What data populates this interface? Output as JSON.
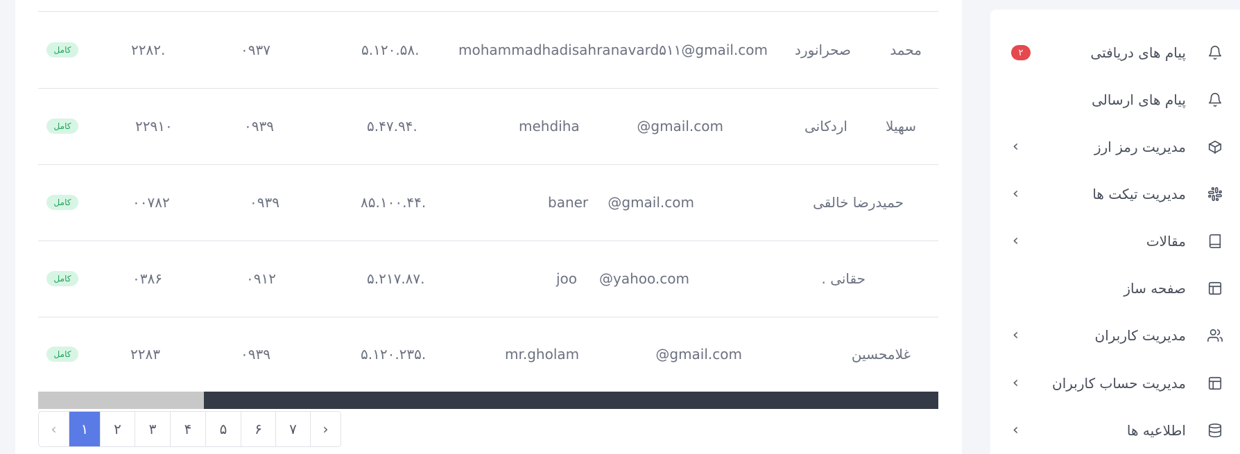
{
  "table": {
    "rows": [
      {
        "name": "محمد",
        "family": "صحرانورد",
        "email": "mohammadhadisahranavard۵۱۱@gmail.com",
        "ip": "۵.۱۲۰.۵۸.",
        "mobile": "۰۹۳۷",
        "code": "۲۲۸۲.",
        "status": "کامل"
      },
      {
        "name": "سهیلا",
        "family": "اردکانی",
        "username": "mehdiha",
        "email": "@gmail.com",
        "ip": "۵.۴۷.۹۴.",
        "mobile": "۰۹۳۹",
        "code": "۲۲۹۱۰",
        "status": "کامل"
      },
      {
        "name": "حمیدرضا خالقی",
        "family": "",
        "username": "baner",
        "email": "@gmail.com",
        "ip": "۸۵.۱۰۰.۴۴.",
        "mobile": "۰۹۳۹",
        "code": "۰۰۷۸۲",
        "status": "کامل"
      },
      {
        "name": "",
        "family": ". حقانی",
        "username": "joo",
        "email": "@yahoo.com",
        "ip": "۵.۲۱۷.۸۷.",
        "mobile": "۰۹۱۲",
        "code": "۰۳۸۶",
        "status": "کامل"
      },
      {
        "name": "غلامحسین",
        "family": "",
        "username": "mr.gholam",
        "email": "@gmail.com",
        "ip": "۵.۱۲۰.۲۳۵.",
        "mobile": "۰۹۳۹",
        "code": "۲۲۸۳",
        "status": "کامل"
      }
    ]
  },
  "scroll": {
    "thumb_fraction": 0.184
  },
  "pagination": {
    "prev": "‹",
    "pages": [
      "۱",
      "۲",
      "۳",
      "۴",
      "۵",
      "۶",
      "۷"
    ],
    "next": "›",
    "active": "۱"
  },
  "sidebar": {
    "items": [
      {
        "label": "پیام های دریافتی",
        "icon": "bell-icon",
        "badge": "۲"
      },
      {
        "label": "پیام های ارسالی",
        "icon": "bell-icon"
      },
      {
        "label": "مدیریت رمز ارز",
        "icon": "cube-icon",
        "chevron": "‹"
      },
      {
        "label": "مدیریت تیکت ها",
        "icon": "slack-icon",
        "chevron": "‹"
      },
      {
        "label": "مقالات",
        "icon": "book-icon",
        "chevron": "‹"
      },
      {
        "label": "صفحه ساز",
        "icon": "layout-icon"
      },
      {
        "label": "مدیریت کاربران",
        "icon": "users-icon",
        "chevron": "‹"
      },
      {
        "label": "مدیریت حساب کاربران",
        "icon": "layout-icon",
        "chevron": "‹"
      },
      {
        "label": "اطلاعیه ها",
        "icon": "database-icon",
        "chevron": "‹"
      }
    ]
  },
  "colors": {
    "accent": "#5a7be6",
    "badge_red": "#e5484d",
    "status_green": "#1fa25a",
    "scroll_track": "#343a46"
  }
}
